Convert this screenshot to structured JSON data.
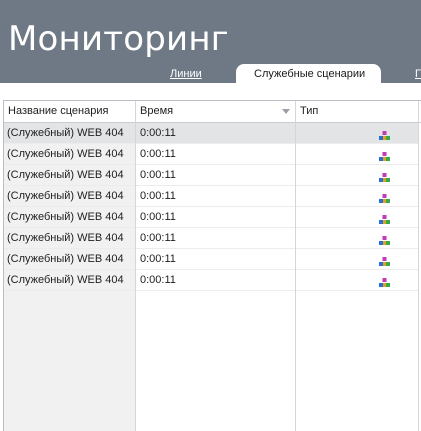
{
  "header": {
    "title": "Мониторинг",
    "background_color": "#6f7985"
  },
  "tabs": [
    {
      "label": "Линии",
      "active": false
    },
    {
      "label": "Служебные сценарии",
      "active": true
    },
    {
      "label": "П",
      "active": false
    }
  ],
  "table": {
    "columns": [
      "Название сценария",
      "Время",
      "Тип"
    ],
    "sorted_column": "Время",
    "rows": [
      {
        "name": "(Служебный) WEB 404",
        "time": "0:00:11",
        "type_icon": "scenario-type-icon",
        "selected": true
      },
      {
        "name": "(Служебный) WEB 404",
        "time": "0:00:11",
        "type_icon": "scenario-type-icon",
        "selected": false
      },
      {
        "name": "(Служебный) WEB 404",
        "time": "0:00:11",
        "type_icon": "scenario-type-icon",
        "selected": false
      },
      {
        "name": "(Служебный) WEB 404",
        "time": "0:00:11",
        "type_icon": "scenario-type-icon",
        "selected": false
      },
      {
        "name": "(Служебный) WEB 404",
        "time": "0:00:11",
        "type_icon": "scenario-type-icon",
        "selected": false
      },
      {
        "name": "(Служебный) WEB 404",
        "time": "0:00:11",
        "type_icon": "scenario-type-icon",
        "selected": false
      },
      {
        "name": "(Служебный) WEB 404",
        "time": "0:00:11",
        "type_icon": "scenario-type-icon",
        "selected": false
      },
      {
        "name": "(Служебный) WEB 404",
        "time": "0:00:11",
        "type_icon": "scenario-type-icon",
        "selected": false
      }
    ]
  }
}
